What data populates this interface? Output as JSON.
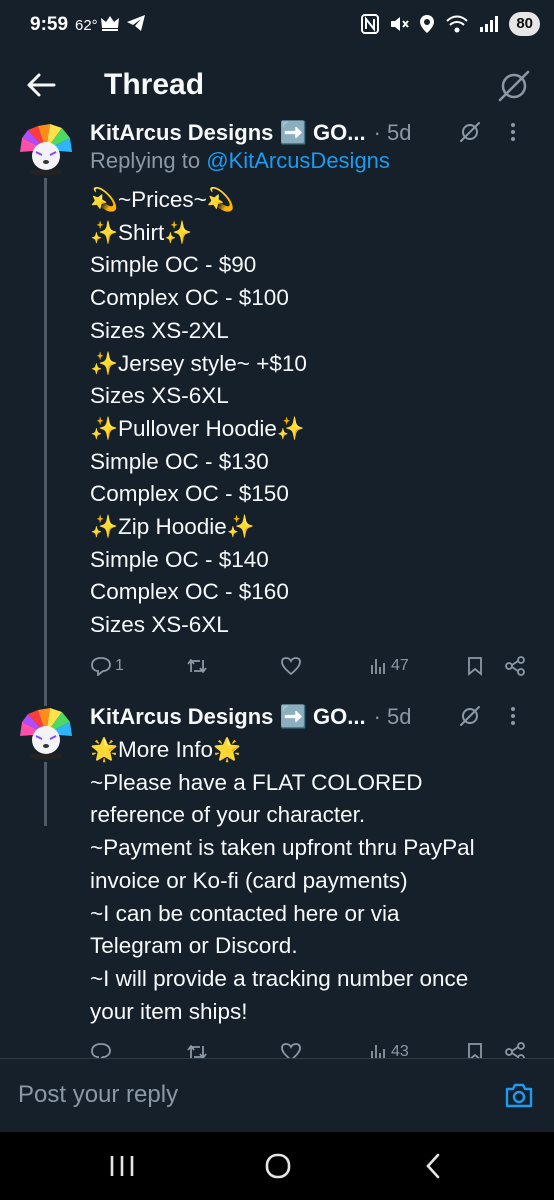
{
  "status_bar": {
    "time": "9:59",
    "temperature": "62°",
    "battery": "80"
  },
  "header": {
    "title": "Thread"
  },
  "tweets": [
    {
      "author": "KitArcus Designs ➡️ GO...",
      "time": "· 5d",
      "replying_prefix": "Replying to ",
      "replying_handle": "@KitArcusDesigns",
      "lines": [
        "💫~Prices~💫",
        "✨Shirt✨",
        "Simple OC - $90",
        "Complex OC - $100",
        "Sizes XS-2XL",
        "✨Jersey style~ +$10",
        "Sizes XS-6XL",
        "✨Pullover Hoodie✨",
        "Simple OC - $130",
        "Complex OC - $150",
        "✨Zip Hoodie✨",
        "Simple OC - $140",
        "Complex OC - $160",
        "Sizes XS-6XL"
      ],
      "reply_count": "1",
      "views": "47"
    },
    {
      "author": "KitArcus Designs ➡️ GO...",
      "time": "· 5d",
      "lines": [
        "🌟More Info🌟",
        "~Please have a FLAT COLORED",
        "reference of your character.",
        "~Payment is taken upfront thru PayPal",
        "invoice or Ko-fi (card payments)",
        "~I can be contacted here or via",
        "Telegram or Discord.",
        "~I will provide a tracking number once",
        "your item ships!"
      ],
      "views": "43"
    }
  ],
  "reply_bar": {
    "placeholder": "Post your reply"
  },
  "colors": {
    "background": "#15202b",
    "text": "#f7f9f9",
    "muted": "#8b98a5",
    "link": "#1d9bf0"
  }
}
